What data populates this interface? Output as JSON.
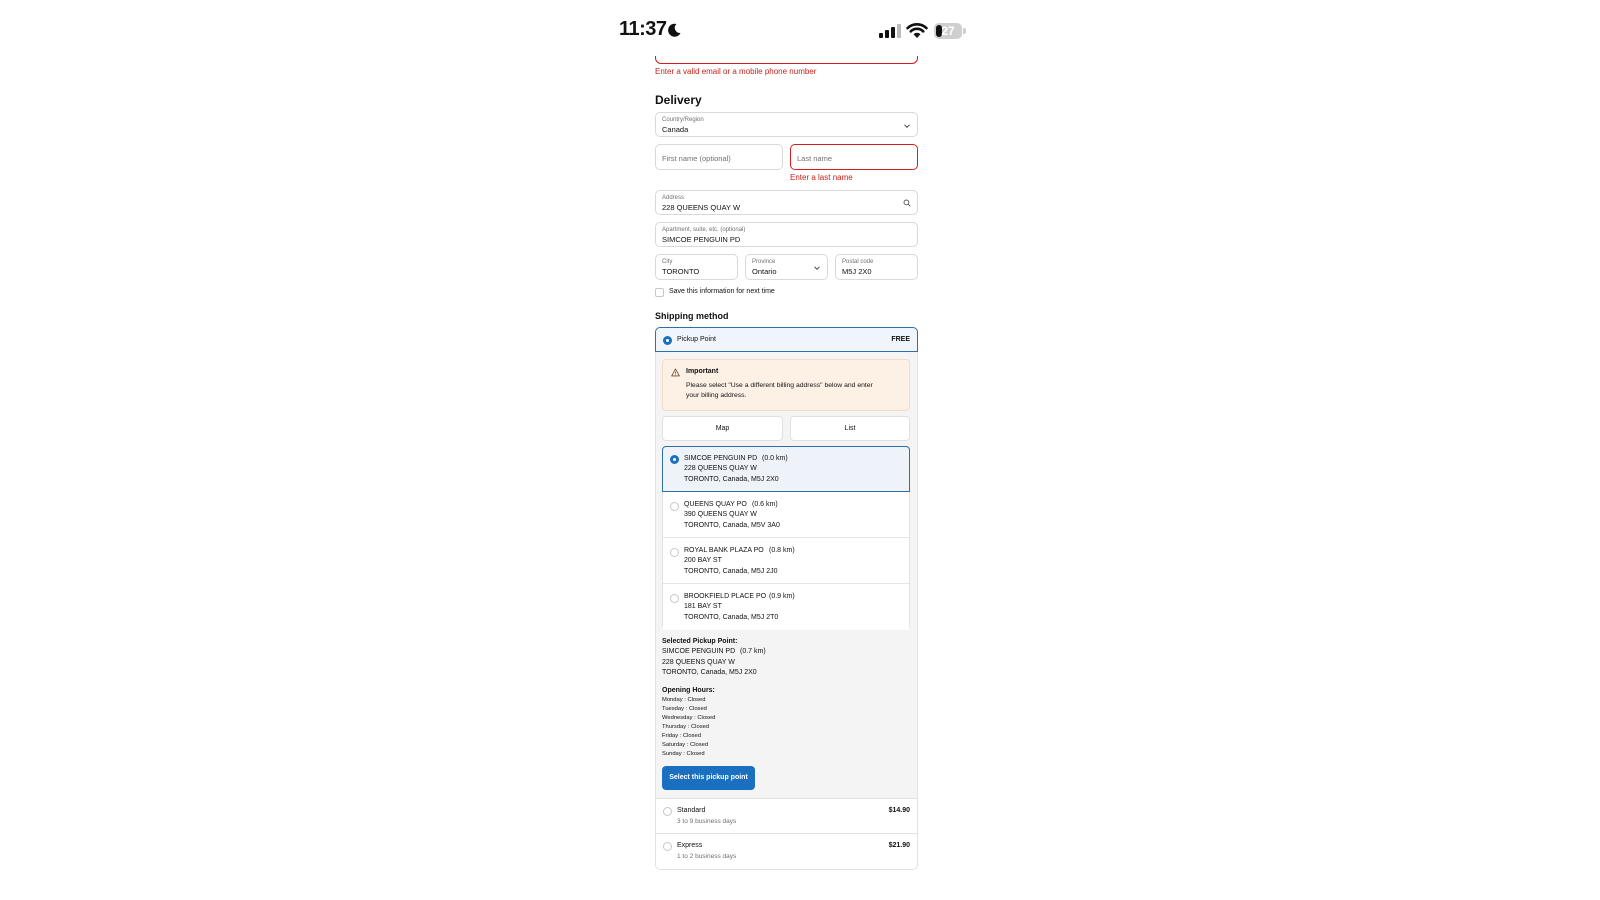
{
  "status_bar": {
    "time": "11:37",
    "battery": "27"
  },
  "contact": {
    "error": "Enter a valid email or a mobile phone number"
  },
  "delivery": {
    "heading": "Delivery",
    "country": {
      "label": "Country/Region",
      "value": "Canada"
    },
    "first_name": {
      "placeholder": "First name (optional)"
    },
    "last_name": {
      "placeholder": "Last name",
      "error": "Enter a last name"
    },
    "address": {
      "label": "Address",
      "value": "228 QUEENS QUAY W"
    },
    "apartment": {
      "label": "Apartment, suite, etc. (optional)",
      "value": "SIMCOE PENGUIN PD"
    },
    "city": {
      "label": "City",
      "value": "TORONTO"
    },
    "province": {
      "label": "Province",
      "value": "Ontario"
    },
    "postal": {
      "label": "Postal code",
      "value": "M5J 2X0"
    },
    "save_info": "Save this information for next time"
  },
  "shipping": {
    "heading": "Shipping method",
    "selected": {
      "name": "Pickup Point",
      "price": "FREE"
    },
    "notice": {
      "title": "Important",
      "line1": "Please select \"Use a different billing address\" below and enter",
      "line2": "your billing address."
    },
    "view_toggle": {
      "map": "Map",
      "list": "List"
    },
    "pickup_points": [
      {
        "name": "SIMCOE PENGUIN PD",
        "distance": "(0.0 km)",
        "street": "228 QUEENS QUAY W",
        "city": "TORONTO, Canada, M5J 2X0"
      },
      {
        "name": "QUEENS QUAY PO",
        "distance": "(0.6 km)",
        "street": "390 QUEENS QUAY W",
        "city": "TORONTO, Canada, M5V 3A0"
      },
      {
        "name": "ROYAL BANK PLAZA PO",
        "distance": "(0.8 km)",
        "street": "200 BAY ST",
        "city": "TORONTO, Canada, M5J 2J0"
      },
      {
        "name": "BROOKFIELD PLACE PO",
        "distance": "(0.9 km)",
        "street": "181 BAY ST",
        "city": "TORONTO, Canada, M5J 2T0"
      }
    ],
    "selected_point": {
      "title": "Selected Pickup Point:",
      "name": "SIMCOE PENGUIN PD",
      "distance": "(0.7 km)",
      "street": "228 QUEENS QUAY W",
      "city": "TORONTO, Canada, M5J 2X0"
    },
    "hours": {
      "title": "Opening Hours:",
      "days": [
        "Monday : Closed",
        "Tuesday : Closed",
        "Wednesday : Closed",
        "Thursday : Closed",
        "Friday : Closed",
        "Saturday : Closed",
        "Sunday : Closed"
      ]
    },
    "select_button": "Select this pickup point",
    "rates": [
      {
        "name": "Standard",
        "sub": "3 to 9 business days",
        "price": "$14.90"
      },
      {
        "name": "Express",
        "sub": "1 to 2 business days",
        "price": "$21.90"
      }
    ]
  },
  "colors": {
    "accent": "#1a6fc0",
    "error": "#c8211b",
    "notice_bg": "#fdf1e6"
  }
}
